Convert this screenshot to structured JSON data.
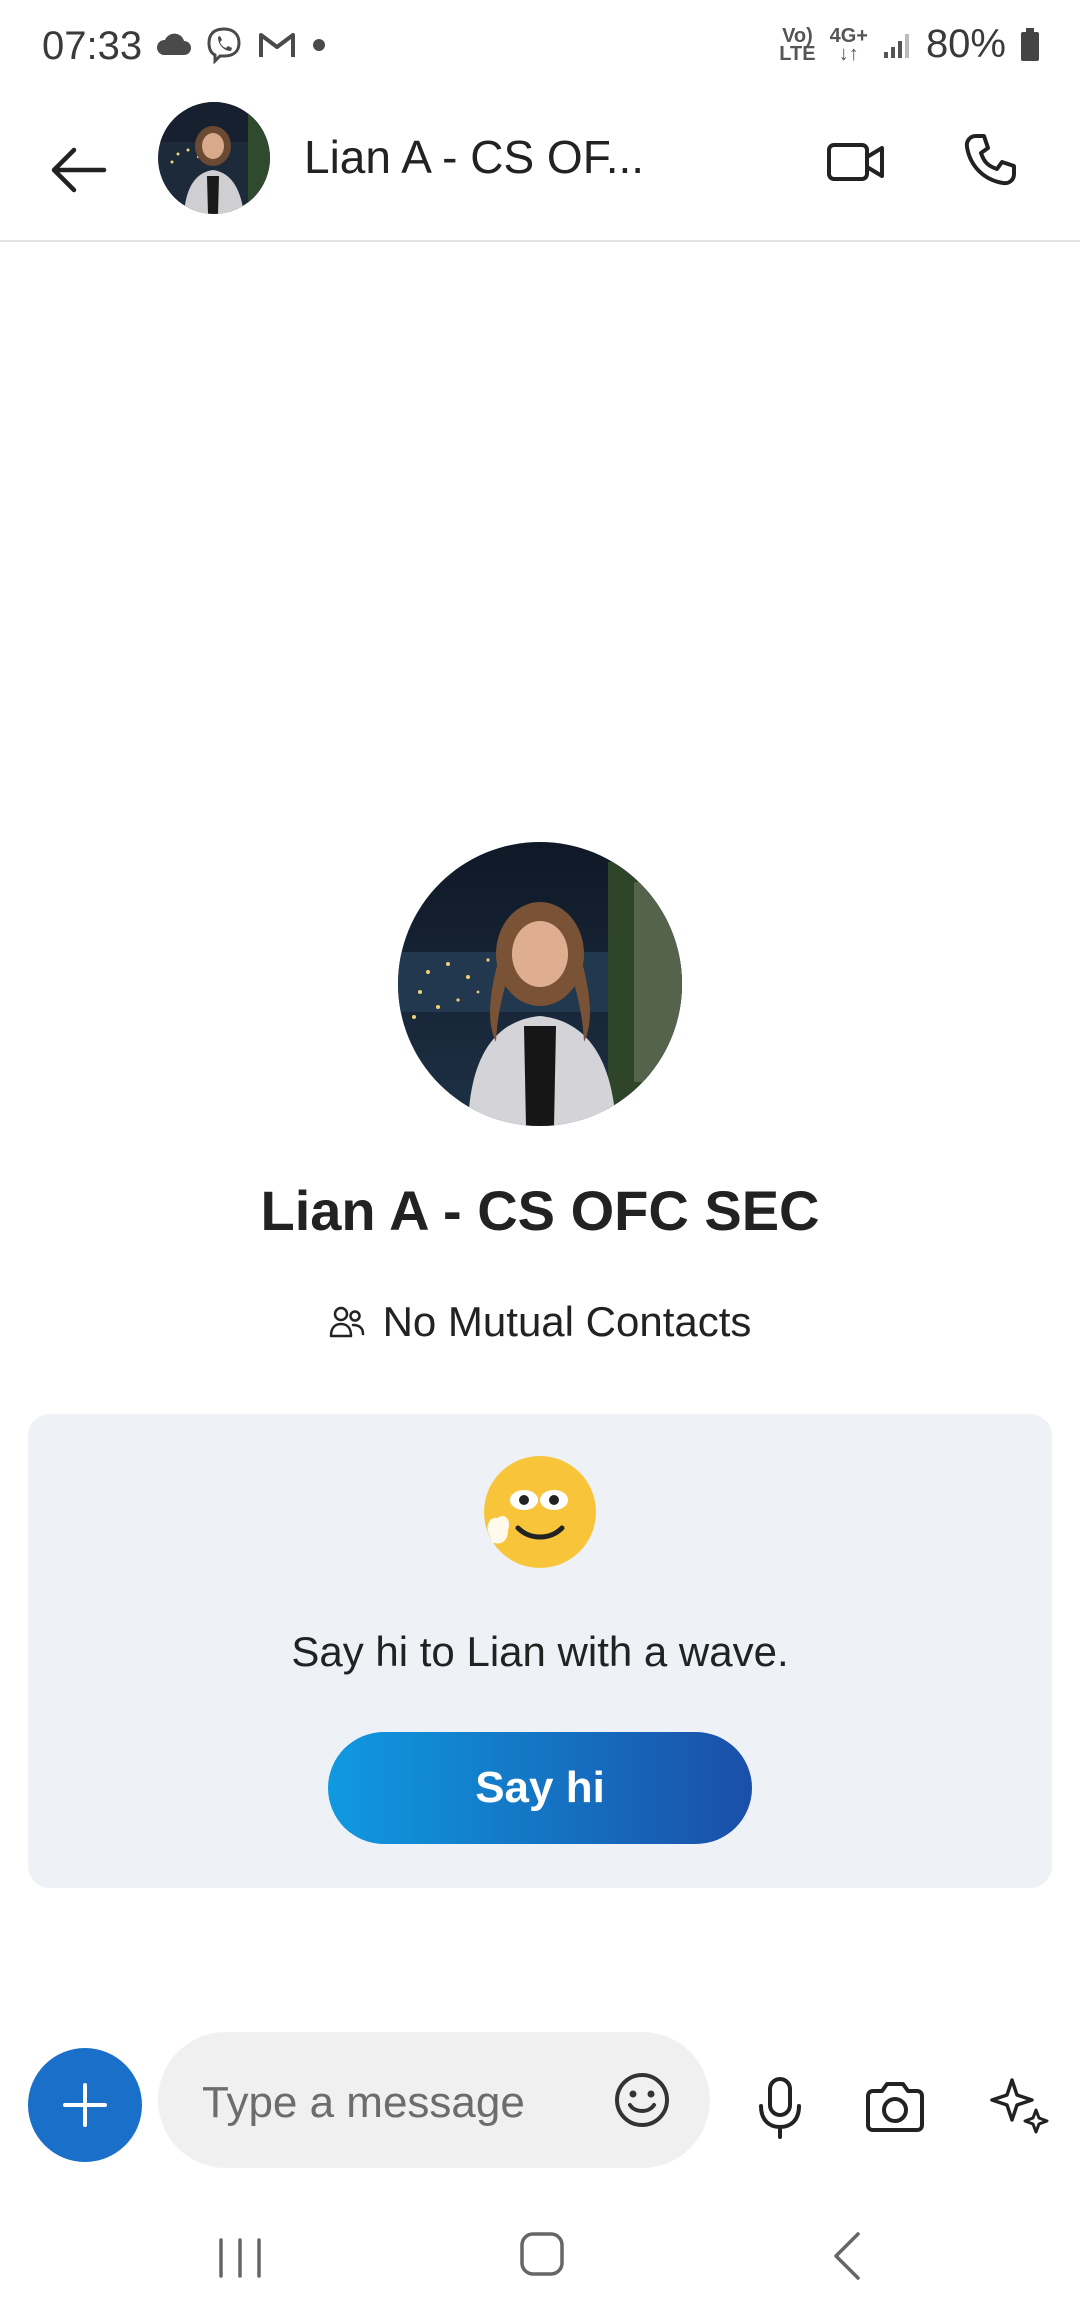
{
  "status_bar": {
    "time": "07:33",
    "battery_percent": "80%",
    "network_volte": "Vo)\nLTE",
    "network_4g": "4G+\n↓↑",
    "icons": [
      "cloud-icon",
      "viber-icon",
      "gmail-icon",
      "dot-icon",
      "signal-icon",
      "battery-icon"
    ]
  },
  "header": {
    "contact_name_truncated": "Lian A - CS OF...",
    "icons": [
      "back-arrow-icon",
      "video-call-icon",
      "phone-call-icon"
    ]
  },
  "profile": {
    "name": "Lian A - CS OFC SEC",
    "mutual_contacts": "No Mutual Contacts"
  },
  "greeting_card": {
    "text": "Say hi to Lian with a wave.",
    "button_label": "Say hi"
  },
  "compose": {
    "placeholder": "Type a message",
    "icons": [
      "plus-icon",
      "emoji-icon",
      "microphone-icon",
      "camera-icon",
      "sparkle-icon"
    ]
  },
  "colors": {
    "accent_blue": "#1a6fc9",
    "button_gradient_start": "#0f9ae0",
    "button_gradient_end": "#1a4fa8",
    "card_background": "#eef1f6"
  }
}
